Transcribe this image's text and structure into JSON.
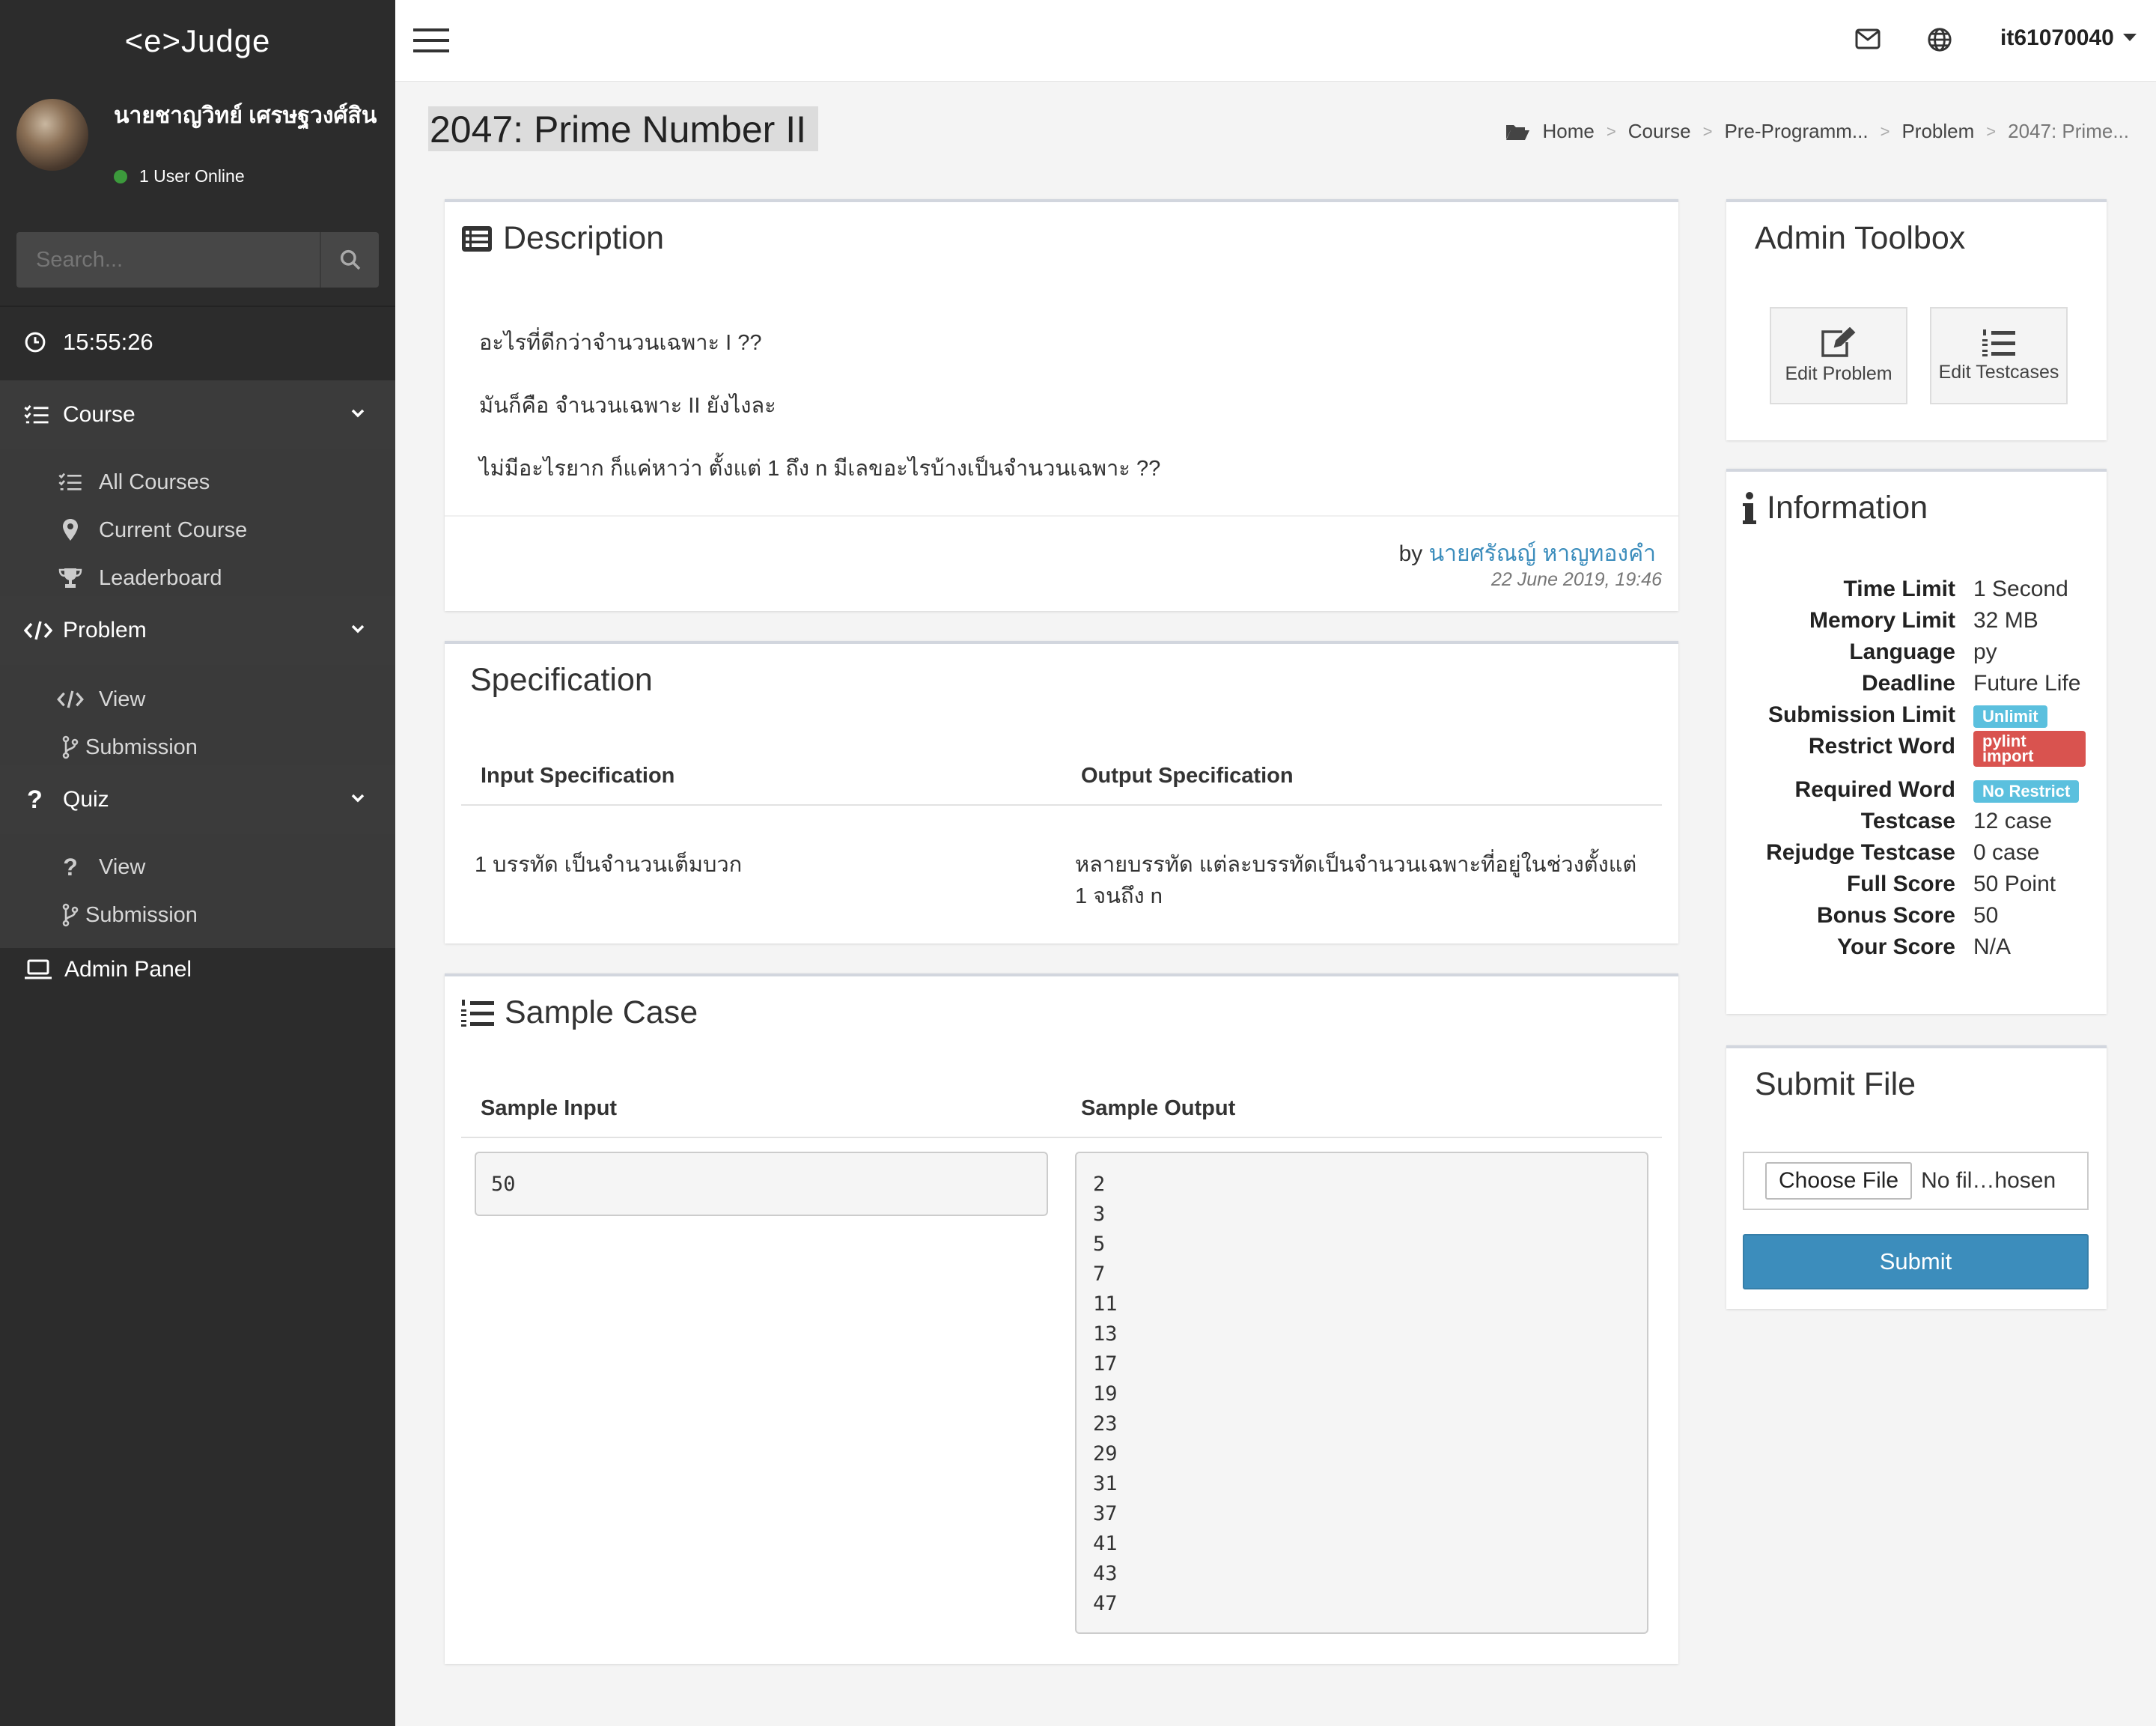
{
  "app": {
    "logo": "<e>Judge"
  },
  "user": {
    "name": "นายชาญวิทย์ เศรษฐวงศ์สิน",
    "status": "1 User Online"
  },
  "search": {
    "placeholder": "Search..."
  },
  "clock": {
    "time": "15:55:26"
  },
  "menu": {
    "course": {
      "label": "Course",
      "items": [
        "All Courses",
        "Current Course",
        "Leaderboard"
      ]
    },
    "problem": {
      "label": "Problem",
      "items": [
        "View",
        "Submission"
      ]
    },
    "quiz": {
      "label": "Quiz",
      "items": [
        "View",
        "Submission"
      ]
    },
    "admin": "Admin Panel"
  },
  "topbar": {
    "username": "it61070040"
  },
  "page": {
    "title": "2047: Prime Number II"
  },
  "breadcrumb": [
    "Home",
    "Course",
    "Pre-Programm...",
    "Problem",
    "2047: Prime..."
  ],
  "description": {
    "title": "Description",
    "lines": [
      "อะไรที่ดีกว่าจำนวนเฉพาะ I ??",
      "มันก็คือ จำนวนเฉพาะ II ยังไงละ",
      "ไม่มีอะไรยาก ก็แค่หาว่า ตั้งแต่ 1 ถึง n มีเลขอะไรบ้างเป็นจำนวนเฉพาะ ??"
    ],
    "by_prefix": "by",
    "author": "นายศรัณญ์ หาญทองคำ",
    "date": "22 June 2019, 19:46"
  },
  "specification": {
    "title": "Specification",
    "input_header": "Input Specification",
    "output_header": "Output Specification",
    "input": "1 บรรทัด เป็นจำนวนเต็มบวก",
    "output_line1": "หลายบรรทัด แต่ละบรรทัดเป็นจำนวนเฉพาะที่อยู่ในช่วงตั้งแต่",
    "output_line2": "1 จนถึง n"
  },
  "sample": {
    "title": "Sample Case",
    "input_header": "Sample Input",
    "output_header": "Sample Output",
    "input": "50",
    "output": [
      "2",
      "3",
      "5",
      "7",
      "11",
      "13",
      "17",
      "19",
      "23",
      "29",
      "31",
      "37",
      "41",
      "43",
      "47"
    ]
  },
  "toolbox": {
    "title": "Admin Toolbox",
    "edit_problem": "Edit Problem",
    "edit_testcases": "Edit Testcases"
  },
  "information": {
    "title": "Information",
    "rows": [
      {
        "key": "Time Limit",
        "value": "1 Second"
      },
      {
        "key": "Memory Limit",
        "value": "32 MB"
      },
      {
        "key": "Language",
        "value": "py"
      },
      {
        "key": "Deadline",
        "value": "Future Life"
      },
      {
        "key": "Submission Limit",
        "badge": "Unlimit",
        "badge_color": "#5bc0de"
      },
      {
        "key": "Restrict Word",
        "badge": "pylint import",
        "badge_color": "#d9534f"
      },
      {
        "key": "Required Word",
        "badge": "No Restrict",
        "badge_color": "#5bc0de"
      },
      {
        "key": "Testcase",
        "value": "12 case"
      },
      {
        "key": "Rejudge Testcase",
        "value": "0 case"
      },
      {
        "key": "Full Score",
        "value": "50 Point"
      },
      {
        "key": "Bonus Score",
        "value": "50"
      },
      {
        "key": "Your Score",
        "value": "N/A"
      }
    ]
  },
  "submit": {
    "title": "Submit File",
    "choose_file": "Choose File",
    "file_status": "No fil…hosen",
    "button": "Submit"
  },
  "colors": {
    "sidebar": "#2c2c2c",
    "accent": "#3c8dbc",
    "info_badge": "#5bc0de",
    "danger_badge": "#d9534f",
    "online": "#3c9a3c"
  }
}
